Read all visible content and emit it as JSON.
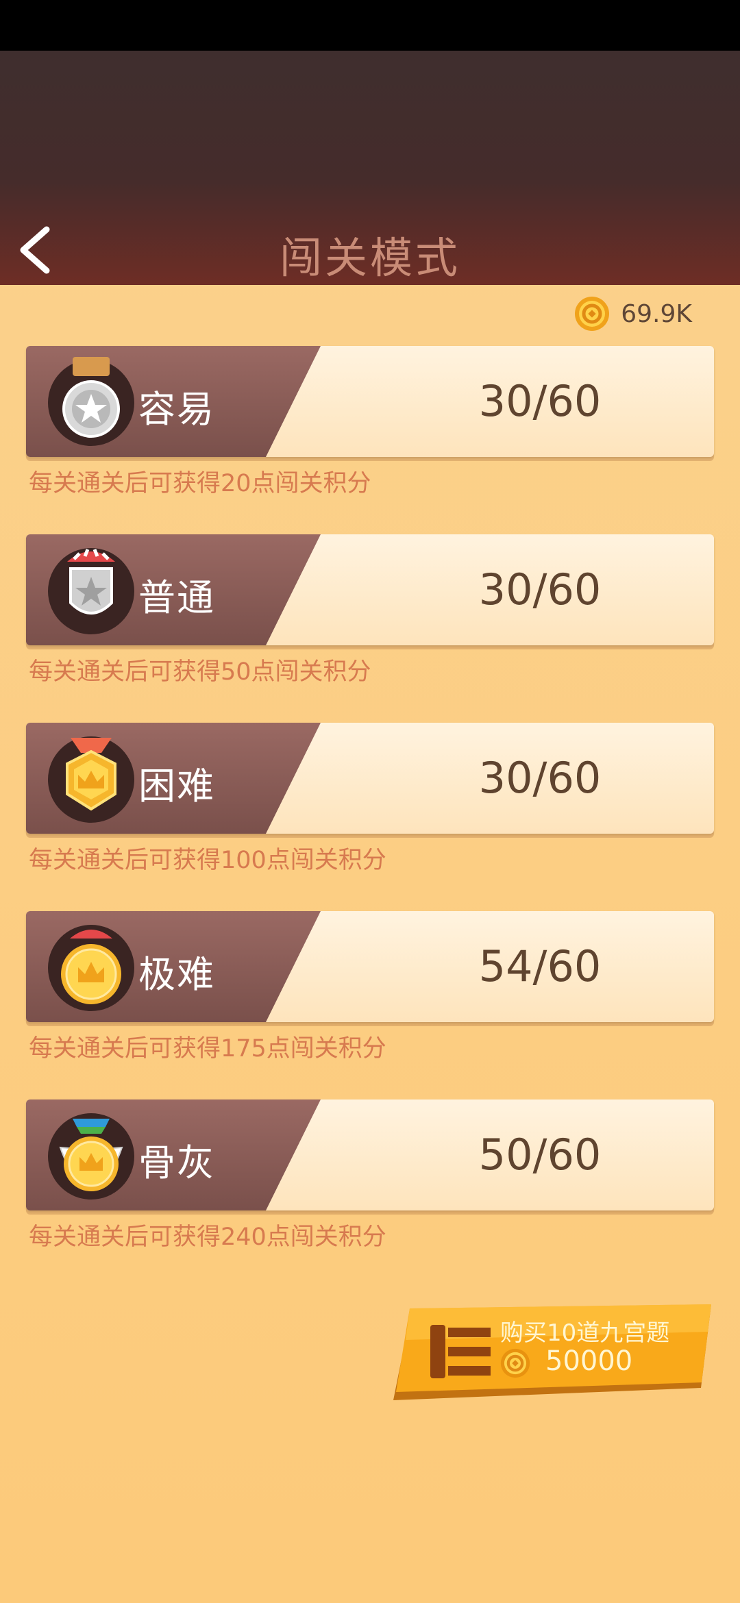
{
  "header": {
    "title": "闯关模式"
  },
  "wallet": {
    "coins": "69.9K"
  },
  "levels": [
    {
      "name": "容易",
      "progress": "30/60",
      "reward": "每关通关后可获得20点闯关积分",
      "medal": "silver-star-medal-icon"
    },
    {
      "name": "普通",
      "progress": "30/60",
      "reward": "每关通关后可获得50点闯关积分",
      "medal": "silver-shield-medal-icon"
    },
    {
      "name": "困难",
      "progress": "30/60",
      "reward": "每关通关后可获得100点闯关积分",
      "medal": "gold-crown-medal-icon"
    },
    {
      "name": "极难",
      "progress": "54/60",
      "reward": "每关通关后可获得175点闯关积分",
      "medal": "gold-sun-medal-icon"
    },
    {
      "name": "骨灰",
      "progress": "50/60",
      "reward": "每关通关后可获得240点闯关积分",
      "medal": "gold-winged-medal-icon"
    }
  ],
  "purchase": {
    "label": "购买10道九宫题",
    "price": "50000"
  },
  "colors": {
    "accent": "#f5a623",
    "dark_card": "#7a504b",
    "reward_text": "#d77a4f"
  }
}
